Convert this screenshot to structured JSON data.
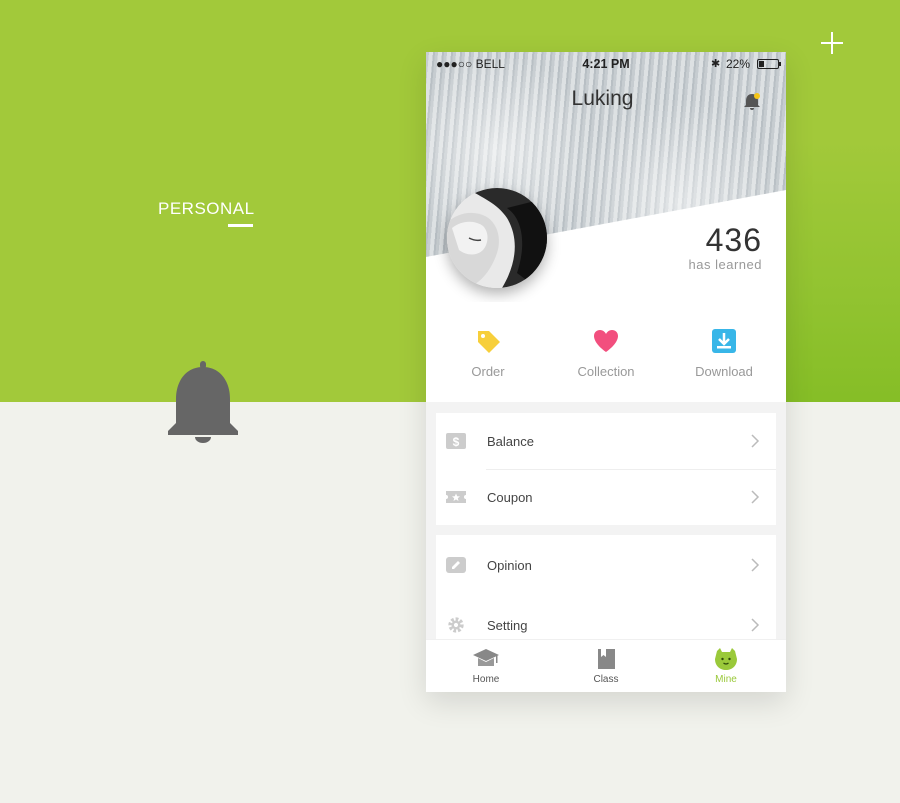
{
  "page": {
    "section_title": "PERSONAL"
  },
  "status_bar": {
    "carrier": "●●●○○ BELL",
    "time": "4:21 PM",
    "battery": "22%"
  },
  "profile": {
    "name": "Luking",
    "learned_count": "436",
    "learned_label": "has learned"
  },
  "actions": [
    {
      "label": "Order",
      "icon": "tag-icon",
      "color": "#f7cf3b"
    },
    {
      "label": "Collection",
      "icon": "heart-icon",
      "color": "#f24f7e"
    },
    {
      "label": "Download",
      "icon": "download-icon",
      "color": "#38b6e8"
    }
  ],
  "menu": {
    "group1": [
      {
        "label": "Balance",
        "icon": "dollar-icon"
      },
      {
        "label": "Coupon",
        "icon": "ticket-icon"
      }
    ],
    "group2": [
      {
        "label": "Opinion",
        "icon": "pencil-icon"
      },
      {
        "label": "Setting",
        "icon": "gear-icon"
      }
    ]
  },
  "tabbar": [
    {
      "label": "Home",
      "icon": "graduation-cap-icon",
      "active": false
    },
    {
      "label": "Class",
      "icon": "book-icon",
      "active": false
    },
    {
      "label": "Mine",
      "icon": "smiley-icon",
      "active": true
    }
  ],
  "colors": {
    "brand_green": "#a2c93a",
    "active_tab": "#9ac93a",
    "notification_dot": "#f5c518"
  }
}
